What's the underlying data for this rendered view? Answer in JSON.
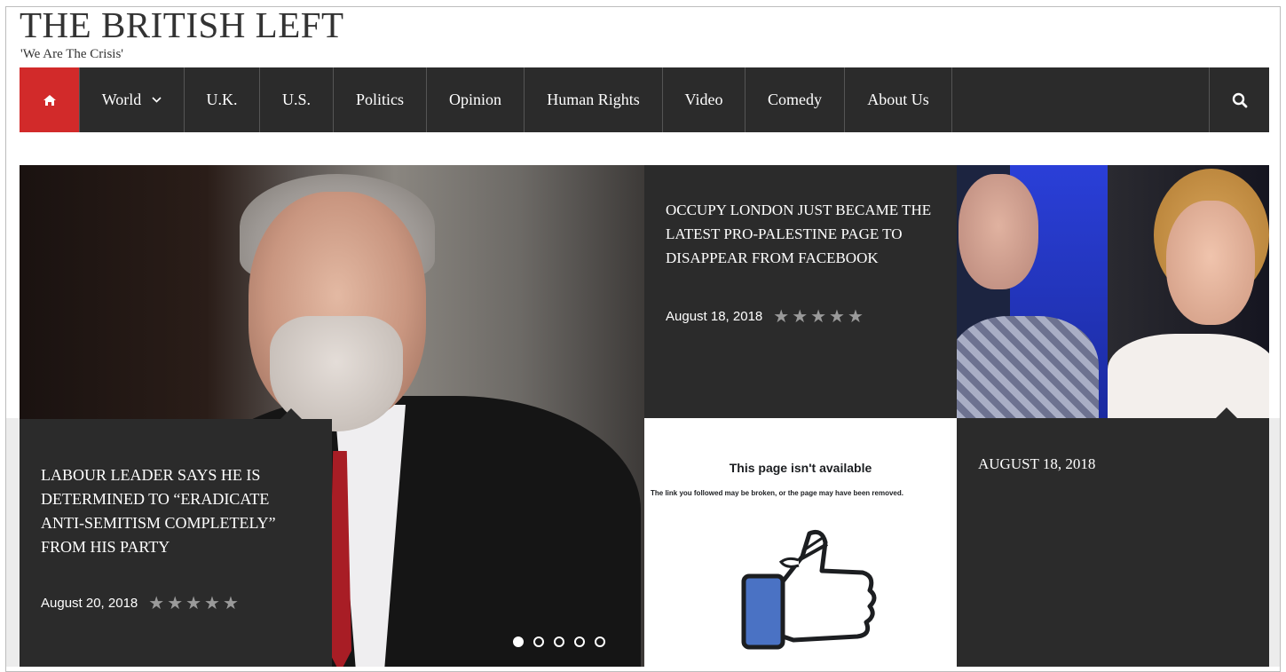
{
  "site": {
    "title": "THE BRITISH LEFT",
    "tagline": "'We Are The Crisis'"
  },
  "nav": {
    "home_icon": "home-icon",
    "items": [
      {
        "label": "World",
        "has_dropdown": true
      },
      {
        "label": "U.K."
      },
      {
        "label": "U.S."
      },
      {
        "label": "Politics"
      },
      {
        "label": "Opinion"
      },
      {
        "label": "Human Rights"
      },
      {
        "label": "Video"
      },
      {
        "label": "Comedy"
      },
      {
        "label": "About Us"
      }
    ],
    "search_icon": "search-icon",
    "home_color": "#d22a2a",
    "bar_color": "#2b2b2b"
  },
  "slider": {
    "main": {
      "headline": "LABOUR LEADER SAYS HE IS DETERMINED TO “ERADICATE ANTI-SEMITISM COMPLETELY” FROM HIS PARTY",
      "date": "August 20, 2018",
      "stars": "★★★★★"
    },
    "dots": 5,
    "active_dot": 1
  },
  "cards": {
    "occupy": {
      "headline": "OCCUPY LONDON JUST BECAME THE LATEST PRO-PALESTINE PAGE TO DISAPPEAR FROM FACEBOOK",
      "date": "August 18, 2018",
      "stars": "★★★★★"
    },
    "facebook_image": {
      "title": "This page isn't available",
      "subtitle": "The link you followed may be broken, or the page may have been removed."
    },
    "bottom_right": {
      "date": "AUGUST 18, 2018"
    }
  }
}
